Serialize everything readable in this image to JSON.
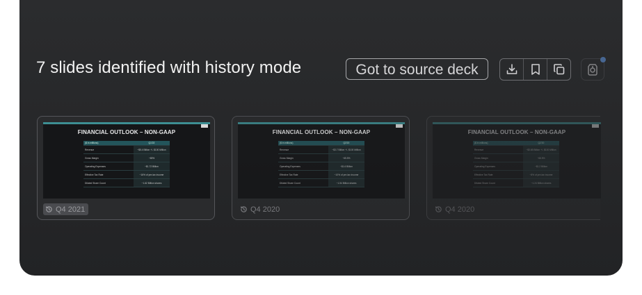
{
  "header": {
    "title": "7 slides identified with history mode",
    "source_button": "Got to source deck"
  },
  "toolbar": {
    "icons": [
      "download-icon",
      "bookmark-icon",
      "copy-icon"
    ],
    "ai_icon": "ai-assistant-icon",
    "accent": "#5b8fd6"
  },
  "slides": [
    {
      "title": "FINANCIAL OUTLOOK – NON-GAAP",
      "period": "Q4 2021",
      "active": true,
      "table": {
        "header": [
          "($ in millions)",
          "Q1’22"
        ],
        "rows": [
          [
            "Revenue",
            "~$5.4 Billion +/- $100 Million"
          ],
          [
            "Gross Margin",
            "~65%"
          ],
          [
            "Operating Expenses",
            "~$1.72 Billion"
          ],
          [
            "Effective Tax Rate",
            "~16% of pre-tax income"
          ],
          [
            "Diluted Share Count",
            "~1.62 Billion shares"
          ]
        ]
      }
    },
    {
      "title": "FINANCIAL OUTLOOK – NON-GAAP",
      "period": "Q4 2020",
      "active": false,
      "table": {
        "header": [
          "($ in millions)",
          "Q3’20"
        ],
        "rows": [
          [
            "Revenue",
            "~$3.7 Billion +/- $100 Million"
          ],
          [
            "Gross Margin",
            "~65.5%"
          ],
          [
            "Operating Expenses",
            "~$1.6 Billion"
          ],
          [
            "Effective Tax Rate",
            "~10% of pre-tax income"
          ],
          [
            "Diluted Share Count",
            "~1.54 Billion shares"
          ]
        ]
      }
    },
    {
      "title": "FINANCIAL OUTLOOK – NON-GAAP",
      "period": "Q4 2020",
      "active": false,
      "table": {
        "header": [
          "($ in millions)",
          "Q2’20"
        ],
        "rows": [
          [
            "Revenue",
            "~$3.65 Billion +/- $100 Million"
          ],
          [
            "Gross Margin",
            "~66.5%"
          ],
          [
            "Operating Expenses",
            "~$1.2 Billion"
          ],
          [
            "Effective Tax Rate",
            "~8% of pre-tax income"
          ],
          [
            "Diluted Share Count",
            "~1.24 Billion shares"
          ]
        ]
      }
    }
  ]
}
